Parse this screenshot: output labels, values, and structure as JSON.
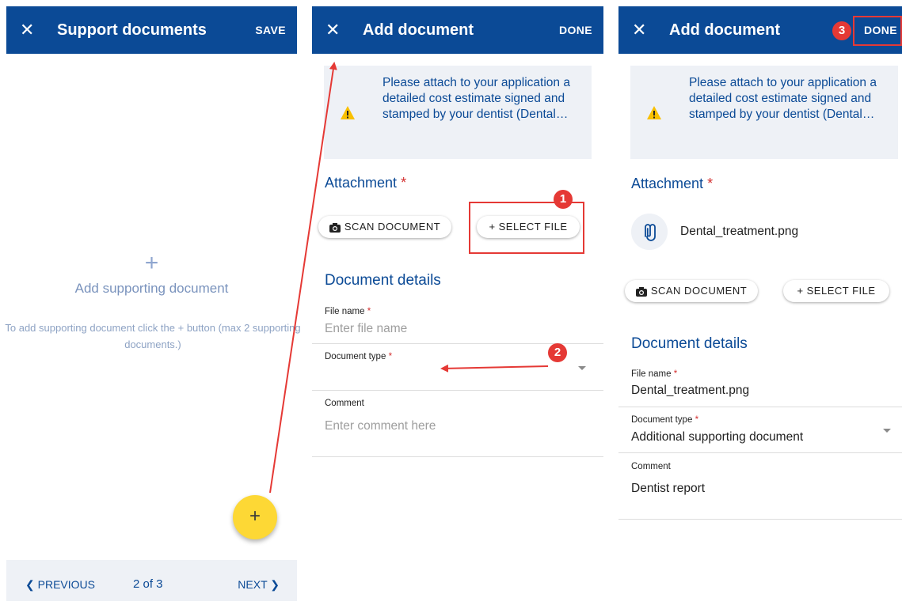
{
  "screen1": {
    "close_icon": "close-icon",
    "title": "Support documents",
    "save": "SAVE",
    "plus": "+",
    "empty_title": "Add supporting document",
    "empty_hint": "To add supporting document click the + button (max 2 supporting documents.)",
    "fab": "+",
    "pager": {
      "prev": "❮ PREVIOUS",
      "count": "2 of 3",
      "next": "NEXT ❯"
    }
  },
  "screen2": {
    "title": "Add document",
    "done": "DONE",
    "notice": "Please attach to your application a detailed cost estimate signed and stamped by your dentist (Dental…",
    "attachment_heading": "Attachment",
    "scan_button": "SCAN DOCUMENT",
    "select_button": "+ SELECT FILE",
    "details_heading": "Document details",
    "file_name_label": "File name",
    "file_name_placeholder": "Enter file name",
    "document_type_label": "Document type",
    "document_type_value": "",
    "comment_label": "Comment",
    "comment_placeholder": "Enter comment here",
    "step1": "1",
    "step2": "2"
  },
  "screen3": {
    "title": "Add document",
    "done": "DONE",
    "step3": "3",
    "notice": "Please attach to your application a detailed cost estimate signed and stamped by your dentist (Dental…",
    "attachment_heading": "Attachment",
    "attached_file": "Dental_treatment.png",
    "scan_button": "SCAN DOCUMENT",
    "select_button": "+ SELECT FILE",
    "details_heading": "Document details",
    "file_name_label": "File name",
    "file_name_value": "Dental_treatment.png",
    "document_type_label": "Document type",
    "document_type_value": "Additional supporting document",
    "comment_label": "Comment",
    "comment_value": "Dentist report"
  },
  "required_mark": "*",
  "colors": {
    "appbar": "#0b4a96",
    "fab": "#fdd835",
    "annotation": "#e53935",
    "notice_bg": "#eef1f6",
    "warning": "#f9c000"
  }
}
